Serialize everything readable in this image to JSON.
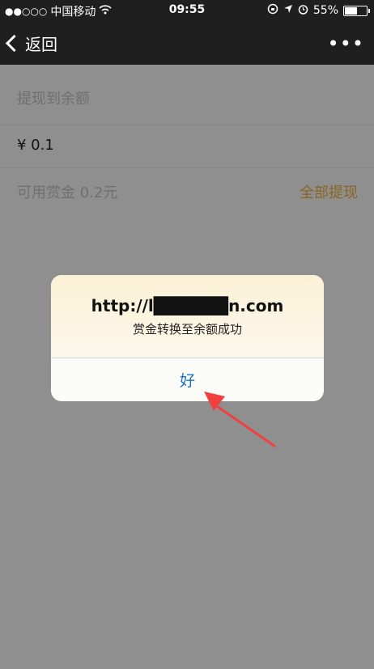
{
  "status": {
    "carrier": "中国移动",
    "time": "09:55",
    "battery": "55%",
    "battery_level": 0.55,
    "icons": [
      "signal-dots",
      "wifi-icon",
      "lock-rotation-icon",
      "location-icon",
      "alarm-icon",
      "battery-icon"
    ]
  },
  "nav": {
    "back_label": "返回",
    "more_label": "•••"
  },
  "form": {
    "withdraw_label": "提现到余额",
    "amount": "¥ 0.1",
    "available_label": "可用赏金 0.2元",
    "withdraw_all": "全部提现"
  },
  "dialog": {
    "title": "http://l██████n.com",
    "message": "赏金转换至余额成功",
    "ok_button": "好"
  },
  "colors": {
    "accent": "#1a73c7",
    "link": "#8a6423",
    "annotation": "#f04040"
  }
}
